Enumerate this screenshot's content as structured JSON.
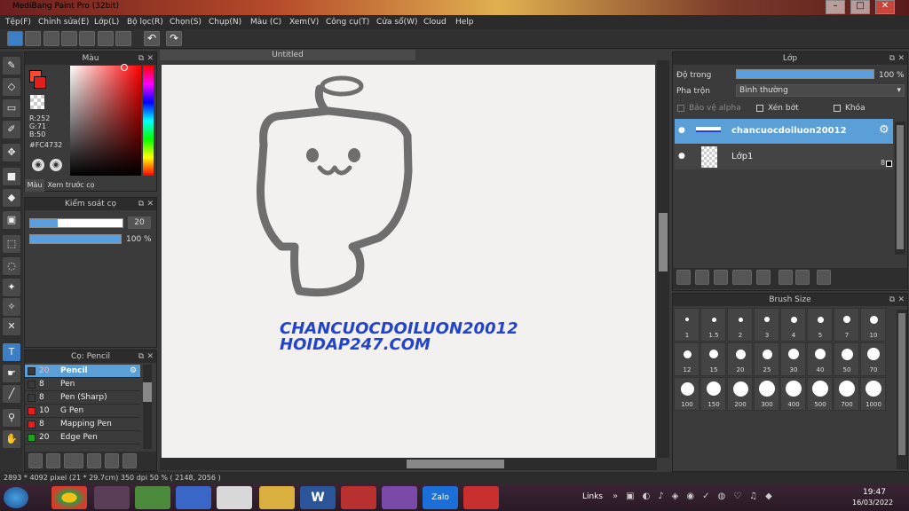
{
  "title": "MediBang Paint Pro (32bit)",
  "menu": [
    "Tệp(F)",
    "Chỉnh sửa(E)",
    "Lớp(L)",
    "Bộ lọc(R)",
    "Chọn(S)",
    "Chụp(N)",
    "Màu (C)",
    "Xem(V)",
    "Công cụ(T)",
    "Cửa sổ(W)",
    "Cloud",
    "Help"
  ],
  "color_panel": {
    "title": "Màu",
    "r": "R:252",
    "g": "G:71",
    "b": "B:50",
    "hex": "#FC4732",
    "tab1": "Màu",
    "tab2": "Xem trước cọ",
    "fg": "#FC4732"
  },
  "brush_ctrl": {
    "title": "Kiểm soát cọ",
    "size": "20",
    "size_frac": 0.3,
    "opacity": "100 %",
    "opacity_frac": 1.0
  },
  "brush_panel": {
    "title": "Cọ: Pencil",
    "items": [
      {
        "size": "20",
        "name": "Pencil",
        "color": "#3a3a3a"
      },
      {
        "size": "8",
        "name": "Pen",
        "color": "#3a3a3a"
      },
      {
        "size": "8",
        "name": "Pen (Sharp)",
        "color": "#3a3a3a"
      },
      {
        "size": "10",
        "name": "G Pen",
        "color": "#e02020"
      },
      {
        "size": "8",
        "name": "Mapping Pen",
        "color": "#e02020"
      },
      {
        "size": "20",
        "name": "Edge Pen",
        "color": "#20a020"
      }
    ]
  },
  "doc_tab": "Untitled",
  "canvas_text1": "CHANCUOCDOILUON20012",
  "canvas_text2": "HOIDAP247.COM",
  "layer_panel": {
    "title": "Lớp",
    "opacity_label": "Độ trong",
    "opacity_value": "100 %",
    "blend_label": "Pha trộn",
    "blend_value": "Bình thường",
    "protect_alpha": "Bảo vệ alpha",
    "clip": "Xén bớt",
    "lock": "Khóa",
    "layers": [
      {
        "name": "chancuocdoiluon20012"
      },
      {
        "name": "Lớp1"
      }
    ],
    "layer1_badge": "8"
  },
  "brush_size": {
    "title": "Brush Size",
    "sizes": [
      "1",
      "1.5",
      "2",
      "3",
      "4",
      "5",
      "7",
      "10",
      "12",
      "15",
      "20",
      "25",
      "30",
      "40",
      "50",
      "70",
      "100",
      "150",
      "200",
      "300",
      "400",
      "500",
      "700",
      "1000"
    ]
  },
  "status": "2893 * 4092 pixel   (21 * 29.7cm)   350 dpi   50 %   ( 2148, 2056 )",
  "taskbar": {
    "links": "Links",
    "time": "19:47",
    "date": "16/03/2022",
    "zalo": "Zalo"
  }
}
